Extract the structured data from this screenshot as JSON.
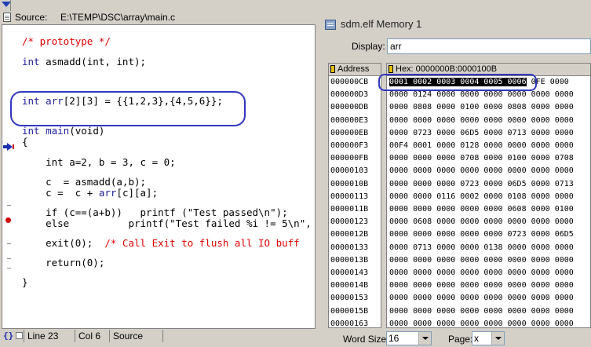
{
  "source_window": {
    "label": "Source:",
    "path": "E:\\TEMP\\DSC\\array\\main.c",
    "code": [
      {
        "parts": [
          {
            "t": "/* prototype */",
            "c": "cm"
          }
        ]
      },
      {
        "parts": [
          {
            "t": "int",
            "c": "kw"
          },
          {
            "t": " asmadd(int, int);",
            "c": ""
          }
        ]
      },
      {
        "parts": [
          {
            "t": "int",
            "c": "kw"
          },
          {
            "t": " ",
            "c": ""
          },
          {
            "t": "arr",
            "c": "kw"
          },
          {
            "t": "[2][3] = {{1,2,3},{4,5,6}};",
            "c": ""
          }
        ]
      },
      {
        "parts": [
          {
            "t": "int",
            "c": "kw"
          },
          {
            "t": " ",
            "c": ""
          },
          {
            "t": "main",
            "c": "kw"
          },
          {
            "t": "(void)",
            "c": ""
          }
        ]
      },
      {
        "parts": [
          {
            "t": "{",
            "c": ""
          }
        ]
      },
      {
        "parts": [
          {
            "t": "    int a=2, b = 3, c = 0;",
            "c": ""
          }
        ]
      },
      {
        "parts": [
          {
            "t": "    c  = asmadd(a,b);",
            "c": ""
          }
        ]
      },
      {
        "parts": [
          {
            "t": "    c =  c + ",
            "c": ""
          },
          {
            "t": "arr",
            "c": "kw"
          },
          {
            "t": "[c][a];",
            "c": ""
          }
        ]
      },
      {
        "parts": [
          {
            "t": "    if (c==(a+b))   printf (\"Test passed\\n\");",
            "c": ""
          }
        ]
      },
      {
        "parts": [
          {
            "t": "    else          printf(\"Test failed %i != 5\\n\",",
            "c": ""
          }
        ]
      },
      {
        "parts": [
          {
            "t": "    exit(0);  ",
            "c": ""
          },
          {
            "t": "/* Call Exit to flush all IO buff",
            "c": "cm"
          }
        ]
      },
      {
        "parts": [
          {
            "t": "    return(0);",
            "c": ""
          }
        ]
      },
      {
        "parts": [
          {
            "t": "}",
            "c": ""
          }
        ]
      }
    ],
    "status": {
      "line": "Line 23",
      "col": "Col 6",
      "mode": "Source"
    }
  },
  "memory_window": {
    "title": "sdm.elf Memory 1",
    "display_label": "Display:",
    "display_value": "arr",
    "address_header": "Address",
    "hex_header": "Hex: 0000000B:0000100B",
    "selected_text": "0001 0002 0003 0004 0005 0006",
    "rows": [
      {
        "addr": "000000CB",
        "hex": "0001 0002 0003 0004 0005 0006 0FE 0000"
      },
      {
        "addr": "000000D3",
        "hex": "0000 0124 0000 0000 0000 0000 0000 0000"
      },
      {
        "addr": "000000DB",
        "hex": "0000 0808 0000 0100 0000 0808 0000 0000"
      },
      {
        "addr": "000000E3",
        "hex": "0000 0000 0000 0000 0000 0000 0000 0000"
      },
      {
        "addr": "000000EB",
        "hex": "0000 0723 0000 06D5 0000 0713 0000 0000"
      },
      {
        "addr": "000000F3",
        "hex": "00F4 0001 0000 0128 0000 0000 0000 0000"
      },
      {
        "addr": "000000FB",
        "hex": "0000 0000 0000 0708 0000 0100 0000 0708"
      },
      {
        "addr": "00000103",
        "hex": "0000 0000 0000 0000 0000 0000 0000 0000"
      },
      {
        "addr": "0000010B",
        "hex": "0000 0000 0000 0723 0000 06D5 0000 0713"
      },
      {
        "addr": "00000113",
        "hex": "0000 0000 0116 0002 0000 0108 0000 0000"
      },
      {
        "addr": "0000011B",
        "hex": "0000 0000 0000 0000 0000 0608 0000 0100"
      },
      {
        "addr": "00000123",
        "hex": "0000 0608 0000 0000 0000 0000 0000 0000"
      },
      {
        "addr": "0000012B",
        "hex": "0000 0000 0000 0000 0000 0723 0000 06D5"
      },
      {
        "addr": "00000133",
        "hex": "0000 0713 0000 0000 0138 0000 0000 0000"
      },
      {
        "addr": "0000013B",
        "hex": "0000 0000 0000 0000 0000 0000 0000 0000"
      },
      {
        "addr": "00000143",
        "hex": "0000 0000 0000 0000 0000 0000 0000 0000"
      },
      {
        "addr": "0000014B",
        "hex": "0000 0000 0000 0000 0000 0000 0000 0000"
      },
      {
        "addr": "00000153",
        "hex": "0000 0000 0000 0000 0000 0000 0000 0000"
      },
      {
        "addr": "0000015B",
        "hex": "0000 0000 0000 0000 0000 0000 0000 0000"
      },
      {
        "addr": "00000163",
        "hex": "0000 0000 0000 0000 0000 0000 0000 0000"
      }
    ],
    "word_size_label": "Word Size:",
    "word_size_value": "16",
    "page_label": "Page:",
    "page_value": "x"
  },
  "colors": {
    "keyword": "#1c1c9c",
    "comment": "#e00000",
    "highlight_outline": "#3038c0",
    "breakpoint": "#d00000"
  }
}
